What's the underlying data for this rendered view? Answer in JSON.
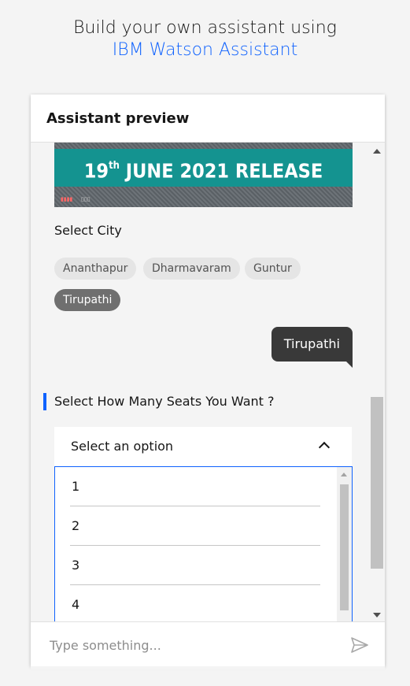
{
  "header": {
    "line1": "Build your own assistant using",
    "line2": "IBM Watson Assistant"
  },
  "panel": {
    "title": "Assistant preview"
  },
  "banner": {
    "day": "19",
    "day_suffix": "th",
    "text": " JUNE 2021 RELEASE",
    "mark": "▮▮▮▮ ▯▯▯"
  },
  "chat": {
    "city_prompt": "Select City",
    "cities": [
      "Ananthapur",
      "Dharmavaram",
      "Guntur",
      "Tirupathi"
    ],
    "selected_city": "Tirupathi",
    "user_reply": "Tirupathi",
    "seats_prompt": "Select How Many Seats You Want ?",
    "dropdown_placeholder": "Select an option",
    "options": [
      "1",
      "2",
      "3",
      "4"
    ]
  },
  "input": {
    "placeholder": "Type something..."
  },
  "icons": {
    "send": "send-icon",
    "chevron": "chevron-up-icon"
  },
  "colors": {
    "accent": "#0f62fe",
    "banner": "#149390",
    "bubble": "#393939"
  }
}
